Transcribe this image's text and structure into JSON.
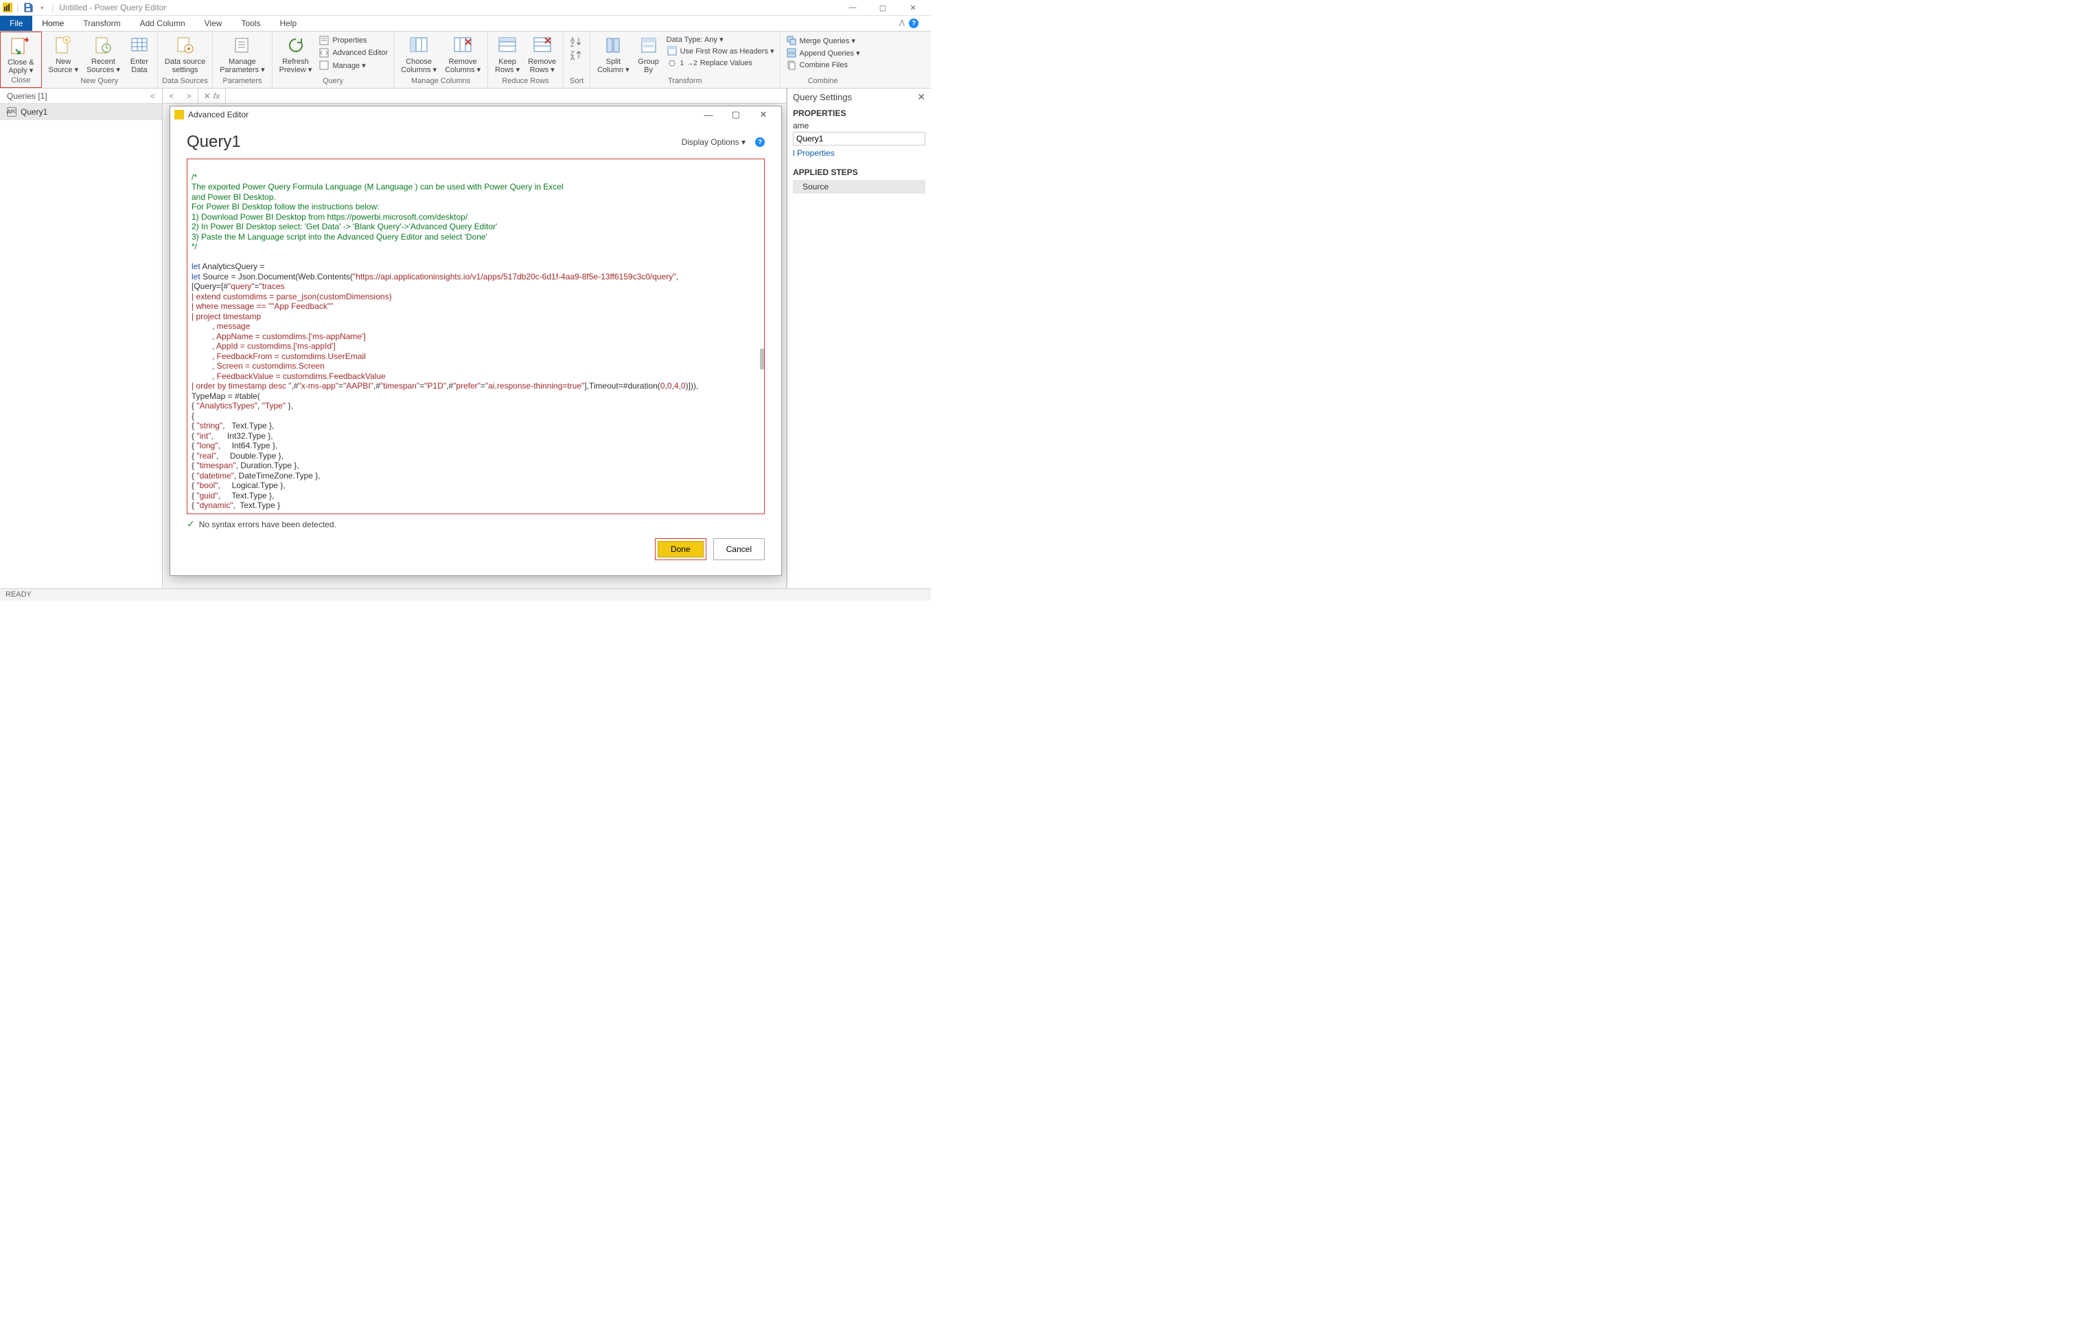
{
  "window": {
    "title": "Untitled - Power Query Editor",
    "min": "—",
    "max": "▢",
    "close": "✕"
  },
  "tabs": {
    "file": "File",
    "home": "Home",
    "transform": "Transform",
    "add_column": "Add Column",
    "view": "View",
    "tools": "Tools",
    "help": "Help"
  },
  "ribbon": {
    "close": {
      "close_apply": "Close &",
      "apply": "Apply ▾",
      "group": "Close"
    },
    "newquery": {
      "new_source": "New",
      "new_source2": "Source ▾",
      "recent_sources": "Recent",
      "recent_sources2": "Sources ▾",
      "enter_data": "Enter",
      "enter_data2": "Data",
      "group": "New Query"
    },
    "datasources": {
      "data_source": "Data source",
      "settings": "settings",
      "group": "Data Sources"
    },
    "parameters": {
      "manage": "Manage",
      "parameters": "Parameters ▾",
      "group": "Parameters"
    },
    "query": {
      "refresh": "Refresh",
      "preview": "Preview ▾",
      "properties": "Properties",
      "advanced_editor": "Advanced Editor",
      "manage": "Manage ▾",
      "group": "Query"
    },
    "manage_columns": {
      "choose": "Choose",
      "choose2": "Columns ▾",
      "remove": "Remove",
      "remove2": "Columns ▾",
      "group": "Manage Columns"
    },
    "reduce_rows": {
      "keep": "Keep",
      "keep2": "Rows ▾",
      "remove": "Remove",
      "remove2": "Rows ▾",
      "group": "Reduce Rows"
    },
    "sort": {
      "group": "Sort"
    },
    "transform": {
      "split": "Split",
      "split2": "Column ▾",
      "group_by": "Group",
      "group_by2": "By",
      "data_type": "Data Type: Any ▾",
      "first_row": "Use First Row as Headers ▾",
      "replace": "Replace Values",
      "group": "Transform"
    },
    "combine": {
      "merge": "Merge Queries ▾",
      "append": "Append Queries ▾",
      "combine_files": "Combine Files",
      "group": "Combine"
    }
  },
  "queries": {
    "header": "Queries [1]",
    "item": "Query1"
  },
  "settings": {
    "title": "Query Settings",
    "properties": "PROPERTIES",
    "name_label": "ame",
    "name_value": "Query1",
    "all_properties": "l Properties",
    "applied_steps": "APPLIED STEPS",
    "step1": "Source"
  },
  "dialog": {
    "title": "Advanced Editor",
    "heading": "Query1",
    "display_options": "Display Options  ▾",
    "syntax_ok": "No syntax errors have been detected.",
    "done": "Done",
    "cancel": "Cancel"
  },
  "code": {
    "c1": "/*",
    "c2": "The exported Power Query Formula Language (M Language ) can be used with Power Query in Excel",
    "c3": "and Power BI Desktop.",
    "c4": "For Power BI Desktop follow the instructions below:",
    "c5": "1) Download Power BI Desktop from https://powerbi.microsoft.com/desktop/",
    "c6": "2) In Power BI Desktop select: 'Get Data' -> 'Blank Query'->'Advanced Query Editor'",
    "c7": "3) Paste the M Language script into the Advanced Query Editor and select 'Done'",
    "c8": "*/",
    "l1a": "let",
    "l1b": " AnalyticsQuery =",
    "l2a": "let",
    "l2b": " Source = Json.Document(Web.Contents(",
    "l2c": "\"https://api.applicationinsights.io/v1/apps/517db20c-6d1f-4aa9-8f5e-13ff6159c3c0/query\"",
    "l2d": ",",
    "l3a": "[Query=[#",
    "l3b": "\"query\"",
    "l3c": "=",
    "l3d": "\"traces",
    "l4": "| extend customdims = parse_json(customDimensions)",
    "l5": "| where message == \"\"App Feedback\"\"",
    "l6": "| project timestamp",
    "l7": "         , message",
    "l8": "         , AppName = customdims.['ms-appName']",
    "l9": "         , AppId = customdims.['ms-appId']",
    "l10": "         , FeedbackFrom = customdims.UserEmail",
    "l11": "         , Screen = customdims.Screen",
    "l12": "         , FeedbackValue = customdims.FeedbackValue",
    "l13a": "| order by timestamp desc \"",
    "l13b": ",#",
    "l13c": "\"x-ms-app\"",
    "l13d": "=",
    "l13e": "\"AAPBI\"",
    "l13f": ",#",
    "l13g": "\"timespan\"",
    "l13h": "=",
    "l13i": "\"P1D\"",
    "l13j": ",#",
    "l13k": "\"prefer\"",
    "l13l": "=",
    "l13m": "\"ai.response-thinning=true\"",
    "l13n": "],Timeout=#duration(",
    "l13o": "0",
    "l13p": ",",
    "l13q": "0",
    "l13r": ",",
    "l13s": "4",
    "l13t": ",",
    "l13u": "0",
    "l13v": ")])),",
    "l14": "TypeMap = #table(",
    "l15a": "{ ",
    "l15b": "\"AnalyticsTypes\"",
    "l15c": ", ",
    "l15d": "\"Type\"",
    "l15e": " },",
    "l16": "{",
    "r1a": "{ ",
    "r1b": "\"string\"",
    "r1c": ",   Text.Type },",
    "r2a": "{ ",
    "r2b": "\"int\"",
    "r2c": ",      Int32.Type },",
    "r3a": "{ ",
    "r3b": "\"long\"",
    "r3c": ",     Int64.Type },",
    "r4a": "{ ",
    "r4b": "\"real\"",
    "r4c": ",     Double.Type },",
    "r5a": "{ ",
    "r5b": "\"timespan\"",
    "r5c": ", Duration.Type },",
    "r6a": "{ ",
    "r6b": "\"datetime\"",
    "r6c": ", DateTimeZone.Type },",
    "r7a": "{ ",
    "r7b": "\"bool\"",
    "r7c": ",     Logical.Type },",
    "r8a": "{ ",
    "r8b": "\"guid\"",
    "r8c": ",     Text.Type },",
    "r9a": "{ ",
    "r9b": "\"dynamic\"",
    "r9c": ",  Text.Type }"
  },
  "status": "READY"
}
